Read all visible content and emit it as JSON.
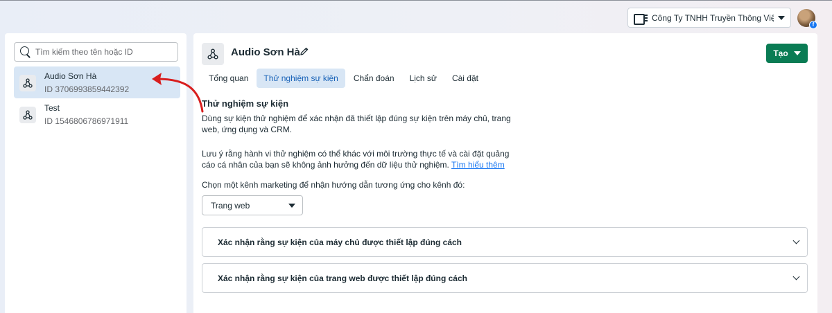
{
  "topbar": {
    "account_name": "Công Ty TNHH Truyền Thông Việ...",
    "icons": {
      "business": "business-manager-icon",
      "caret": "caret-down-icon",
      "avatar": "profile-avatar",
      "badge": "facebook-badge-icon"
    },
    "badge_text": "f"
  },
  "sidebar": {
    "search_placeholder": "Tìm kiếm theo tên hoặc ID",
    "items": [
      {
        "name": "Audio Sơn Hà",
        "id": "ID 3706993859442392",
        "active": true,
        "icon": "dataset-icon"
      },
      {
        "name": "Test",
        "id": "ID 1546806786971911",
        "active": false,
        "icon": "dataset-icon"
      }
    ]
  },
  "main": {
    "title": "Audio Sơn Hà",
    "create_label": "Tạo",
    "tabs": [
      {
        "label": "Tổng quan",
        "active": false
      },
      {
        "label": "Thử nghiệm sự kiện",
        "active": true
      },
      {
        "label": "Chẩn đoán",
        "active": false
      },
      {
        "label": "Lịch sử",
        "active": false
      },
      {
        "label": "Cài đặt",
        "active": false
      }
    ],
    "section_title": "Thử nghiệm sự kiện",
    "para1": "Dùng sự kiện thử nghiệm để xác nhận đã thiết lập đúng sự kiện trên máy chủ, trang web, ứng dụng và CRM.",
    "para2": "Lưu ý rằng hành vi thử nghiệm có thể khác với môi trường thực tế và cài đặt quảng cáo cá nhân của bạn sẽ không ảnh hưởng đến dữ liệu thử nghiệm.",
    "learn_more": "Tìm hiểu thêm",
    "channel_prompt": "Chọn một kênh marketing để nhận hướng dẫn tương ứng cho kênh đó:",
    "channel_selected": "Trang web",
    "accordions": [
      {
        "label": "Xác nhận rằng sự kiện của máy chủ được thiết lập đúng cách"
      },
      {
        "label": "Xác nhận rằng sự kiện của trang web được thiết lập đúng cách"
      }
    ]
  },
  "colors": {
    "primary_green": "#0a7c54",
    "active_bg": "#d8e6f5",
    "active_text": "#1b64b8",
    "link": "#1877f2",
    "annotation_red": "#d81e1e"
  }
}
